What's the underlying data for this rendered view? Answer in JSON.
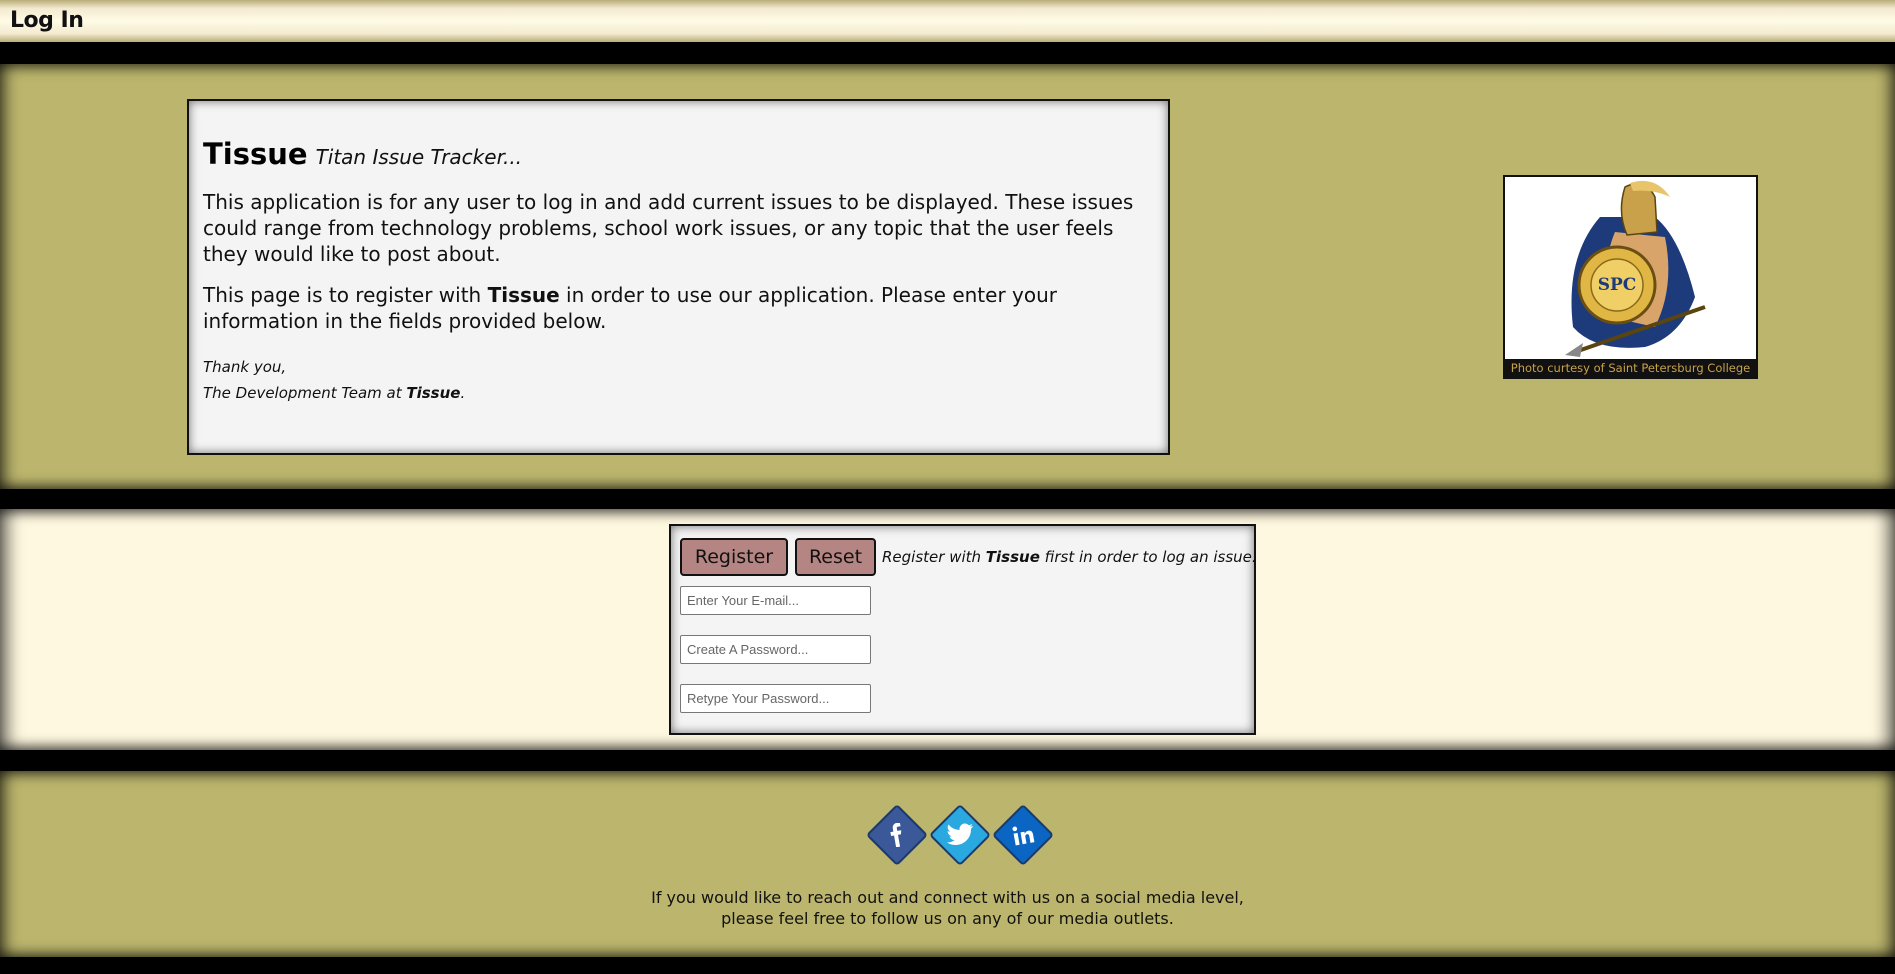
{
  "header": {
    "title": "Log In"
  },
  "intro": {
    "brand": "Tissue",
    "tagline": "Titan Issue Tracker...",
    "para1": "This application is for any user to log in and add current issues to be displayed. These issues could range from technology problems, school work issues, or any topic that the user feels they would like to post about.",
    "para2_pre": "This page is to register with ",
    "para2_brand": "Tissue",
    "para2_post": " in order to use our application. Please enter your information in the fields provided below.",
    "thanks": "Thank you,",
    "team_pre": "The Development Team at ",
    "team_brand": "Tissue",
    "team_post": "."
  },
  "mascot": {
    "badge_text": "SPC",
    "caption": "Photo curtesy of Saint Petersburg College"
  },
  "form": {
    "register_label": "Register",
    "reset_label": "Reset",
    "note_pre": "Register with ",
    "note_brand": "Tissue",
    "note_post": " first in order to log an issue.",
    "email_placeholder": "Enter Your E-mail...",
    "password_placeholder": "Create A Password...",
    "retype_placeholder": "Retype Your Password..."
  },
  "social": {
    "icons": [
      "facebook-icon",
      "twitter-icon",
      "linkedin-icon"
    ],
    "colors": {
      "facebook": "#3b5998",
      "twitter": "#2aa9e0",
      "linkedin": "#0a66c2"
    }
  },
  "footer": {
    "line1": "If you would like to reach out and connect with us on a social media level,",
    "line2": "please feel free to follow us on any of our media outlets."
  },
  "colors": {
    "olive": "#bbb56d",
    "cream": "#fff8e0",
    "panel": "#f4f4f4",
    "button": "#b58583"
  }
}
